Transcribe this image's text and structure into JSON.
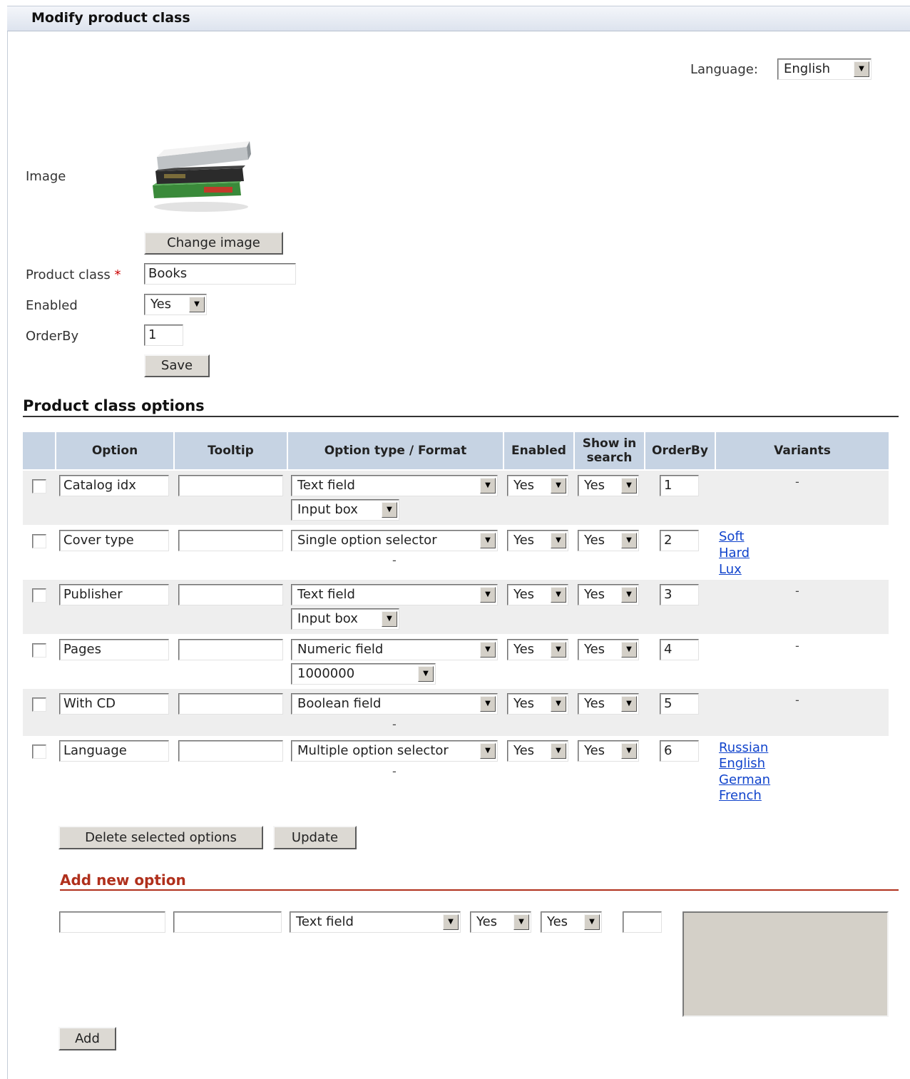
{
  "page": {
    "title": "Modify product class"
  },
  "language": {
    "label": "Language:",
    "value": "English"
  },
  "form": {
    "image_label": "Image",
    "change_image": "Change image",
    "product_class_label": "Product class",
    "required_mark": "*",
    "product_class_value": "Books",
    "enabled_label": "Enabled",
    "enabled_value": "Yes",
    "orderby_label": "OrderBy",
    "orderby_value": "1",
    "save": "Save"
  },
  "options": {
    "title": "Product class options",
    "headers": {
      "option": "Option",
      "tooltip": "Tooltip",
      "type": "Option type / Format",
      "enabled": "Enabled",
      "show_line1": "Show in",
      "show_line2": "search",
      "orderby": "OrderBy",
      "variants": "Variants"
    },
    "rows": [
      {
        "name": "Catalog idx",
        "tooltip": "",
        "type": "Text field",
        "format": "Input box",
        "enabled": "Yes",
        "search": "Yes",
        "order": "1",
        "variants": [],
        "variants_empty": "-"
      },
      {
        "name": "Cover type",
        "tooltip": "",
        "type": "Single option selector",
        "format_dash": "-",
        "enabled": "Yes",
        "search": "Yes",
        "order": "2",
        "variants": [
          "Soft",
          "Hard",
          "Lux"
        ]
      },
      {
        "name": "Publisher",
        "tooltip": "",
        "type": "Text field",
        "format": "Input box",
        "enabled": "Yes",
        "search": "Yes",
        "order": "3",
        "variants": [],
        "variants_empty": "-"
      },
      {
        "name": "Pages",
        "tooltip": "",
        "type": "Numeric field",
        "format": "1000000",
        "enabled": "Yes",
        "search": "Yes",
        "order": "4",
        "variants": [],
        "variants_empty": "-"
      },
      {
        "name": "With CD",
        "tooltip": "",
        "type": "Boolean field",
        "format_dash": "-",
        "enabled": "Yes",
        "search": "Yes",
        "order": "5",
        "variants": [],
        "variants_empty": "-"
      },
      {
        "name": "Language",
        "tooltip": "",
        "type": "Multiple option selector",
        "format_dash": "-",
        "enabled": "Yes",
        "search": "Yes",
        "order": "6",
        "variants": [
          "Russian",
          "English",
          "German",
          "French"
        ]
      }
    ],
    "delete_selected": "Delete selected options",
    "update": "Update"
  },
  "new_option": {
    "title": "Add new option",
    "name": "",
    "tooltip": "",
    "type": "Text field",
    "enabled": "Yes",
    "search": "Yes",
    "order": "",
    "add": "Add"
  },
  "colors": {
    "header_bg": "#c6d3e3",
    "row_alt_bg": "#eeeeee",
    "link": "#1144cc",
    "accent_red": "#b0301c"
  }
}
